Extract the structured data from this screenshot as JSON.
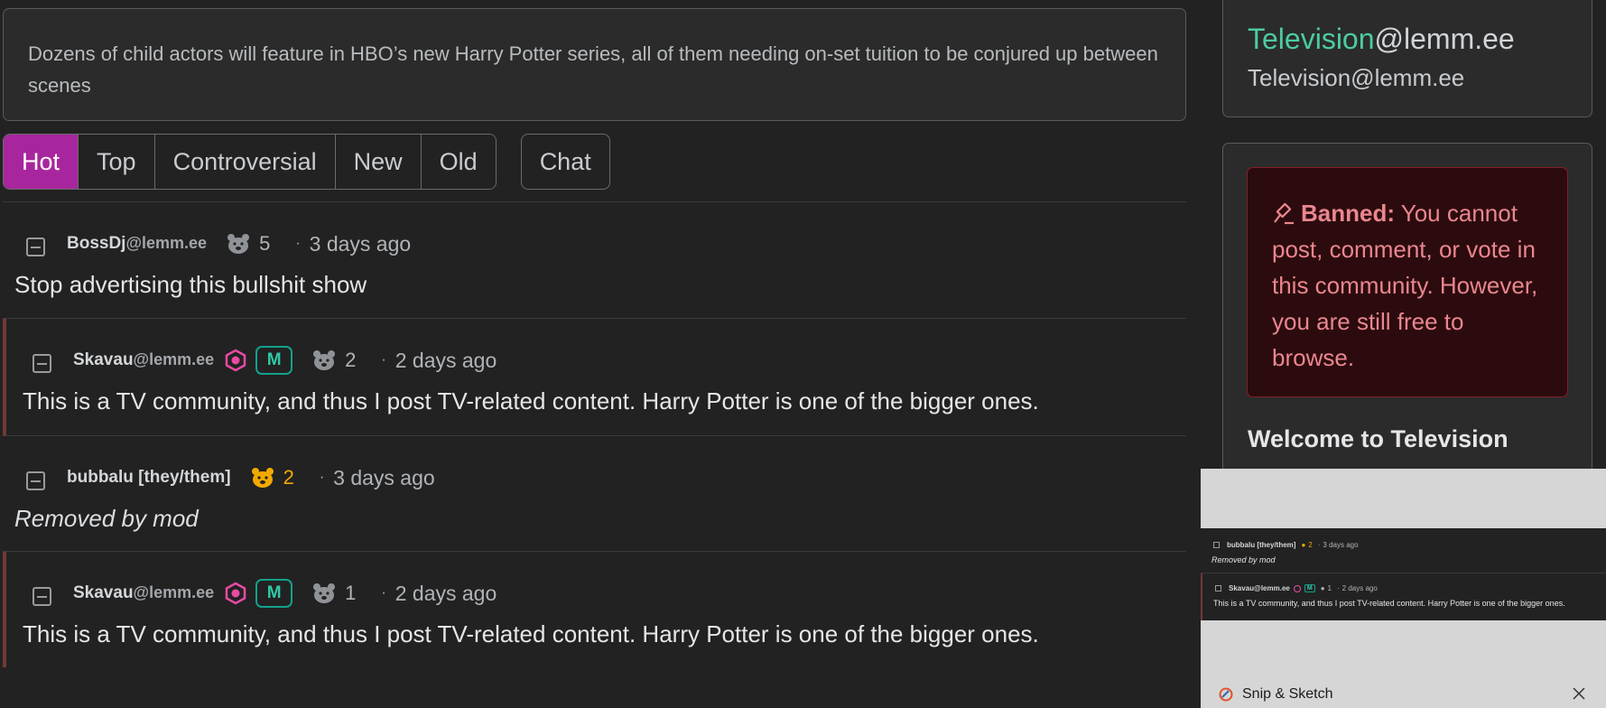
{
  "post": {
    "summary": "Dozens of child actors will feature in HBO’s new Harry Potter series, all of them needing on-set tuition to be conjured up between scenes"
  },
  "sort": {
    "options": [
      "Hot",
      "Top",
      "Controversial",
      "New",
      "Old"
    ],
    "active": "Hot",
    "chat_label": "Chat"
  },
  "comments": [
    {
      "user": "BossDj",
      "instance": "@lemm.ee",
      "score": "5",
      "time": "3 days ago",
      "body": "Stop advertising this bullshit show"
    },
    {
      "user": "Skavau",
      "instance": "@lemm.ee",
      "mod_badge": "M",
      "score": "2",
      "time": "2 days ago",
      "body": "This is a TV community, and thus I post TV-related content. Harry Potter is one of the bigger ones."
    },
    {
      "user": "bubbalu [they/them]",
      "instance": "",
      "score": "2",
      "time": "3 days ago",
      "body": "Removed by mod"
    },
    {
      "user": "Skavau",
      "instance": "@lemm.ee",
      "mod_badge": "M",
      "score": "1",
      "time": "2 days ago",
      "body": "This is a TV community, and thus I post TV-related content. Harry Potter is one of the bigger ones."
    }
  ],
  "sidebar": {
    "community_name": "Television",
    "community_instance": "@lemm.ee",
    "community_subtitle": "Television@lemm.ee",
    "ban_label": "Banned:",
    "ban_text": " You cannot post, comment, or vote in this community. However, you are still free to browse.",
    "welcome": "Welcome to Television"
  },
  "snip": {
    "app_name": "Snip & Sketch",
    "preview": {
      "row1_user": "bubbalu [they/them]",
      "row1_score": "2",
      "row1_time": "3 days ago",
      "row1_body": "Removed by mod",
      "row2_user": "Skavau@lemm.ee",
      "row2_badge": "M",
      "row2_score": "1",
      "row2_time": "2 days ago",
      "row2_body": "This is a TV community, and thus I post TV-related content. Harry Potter is one of the bigger ones."
    }
  },
  "colors": {
    "accent": "#a8269d",
    "mod_green": "#12a18c",
    "ban_bg": "#2c0b0e",
    "ban_text": "#ea868f",
    "community_name": "#4dcba0"
  }
}
